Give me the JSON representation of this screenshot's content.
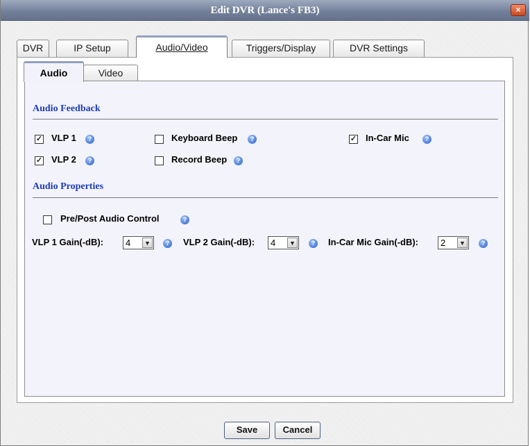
{
  "dialog": {
    "title": "Edit DVR (Lance's FB3)",
    "close_label": "×"
  },
  "tabs": [
    "DVR",
    "IP Setup",
    "Audio/Video",
    "Triggers/Display",
    "DVR Settings"
  ],
  "active_tab": "Audio/Video",
  "subtabs": [
    "Audio",
    "Video"
  ],
  "active_subtab": "Audio",
  "audio_feedback": {
    "title": "Audio Feedback",
    "items": [
      {
        "label": "VLP 1",
        "checked": true
      },
      {
        "label": "VLP 2",
        "checked": true
      },
      {
        "label": "Keyboard Beep",
        "checked": false
      },
      {
        "label": "Record Beep",
        "checked": false
      },
      {
        "label": "In-Car Mic",
        "checked": true
      }
    ]
  },
  "audio_properties": {
    "title": "Audio Properties",
    "pre_post": {
      "label": "Pre/Post Audio Control",
      "checked": false
    },
    "gains": [
      {
        "label": "VLP 1 Gain(-dB):",
        "value": "4"
      },
      {
        "label": "VLP 2 Gain(-dB):",
        "value": "4"
      },
      {
        "label": "In-Car Mic Gain(-dB):",
        "value": "2"
      }
    ]
  },
  "buttons": {
    "save": "Save",
    "cancel": "Cancel"
  },
  "icons": {
    "help": "question-mark-icon",
    "close": "close-icon",
    "dropdown": "chevron-down-icon",
    "check": "checkmark-icon"
  },
  "colors": {
    "section_title": "#1d3bb6",
    "titlebar": "#74819b",
    "close_button": "#c94a22"
  }
}
